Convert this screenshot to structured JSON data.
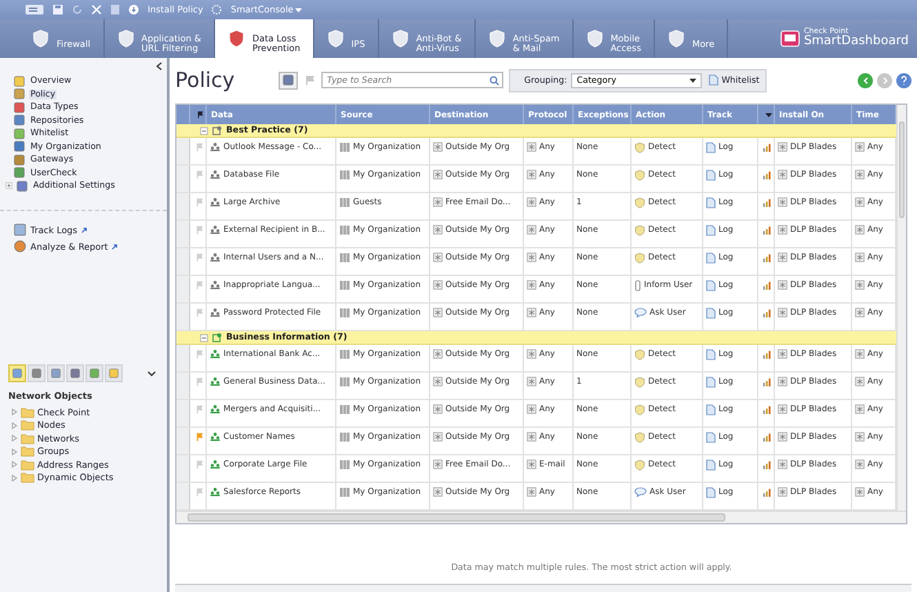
{
  "toolbar": {
    "install": "Install Policy",
    "console": "SmartConsole"
  },
  "tabs": [
    {
      "lines": [
        "Firewall"
      ],
      "selected": false
    },
    {
      "lines": [
        "Application &",
        "URL Filtering"
      ],
      "selected": false
    },
    {
      "lines": [
        "Data Loss",
        "Prevention"
      ],
      "selected": true
    },
    {
      "lines": [
        "IPS"
      ],
      "selected": false
    },
    {
      "lines": [
        "Anti-Bot &",
        "Anti-Virus"
      ],
      "selected": false
    },
    {
      "lines": [
        "Anti-Spam",
        "& Mail"
      ],
      "selected": false
    },
    {
      "lines": [
        "Mobile",
        "Access"
      ],
      "selected": false
    },
    {
      "lines": [
        "More"
      ],
      "selected": false
    }
  ],
  "brand": {
    "line1": "Check Point",
    "line2": "SmartDashboard"
  },
  "nav": [
    {
      "label": "Overview",
      "selected": false,
      "expandable": false
    },
    {
      "label": "Policy",
      "selected": true,
      "expandable": false
    },
    {
      "label": "Data Types",
      "selected": false,
      "expandable": false
    },
    {
      "label": "Repositories",
      "selected": false,
      "expandable": false
    },
    {
      "label": "Whitelist",
      "selected": false,
      "expandable": false
    },
    {
      "label": "My Organization",
      "selected": false,
      "expandable": false
    },
    {
      "label": "Gateways",
      "selected": false,
      "expandable": false
    },
    {
      "label": "UserCheck",
      "selected": false,
      "expandable": false
    },
    {
      "label": "Additional Settings",
      "selected": false,
      "expandable": true
    }
  ],
  "links": [
    "Track Logs",
    "Analyze & Report"
  ],
  "object_tools": [
    {
      "selected": true
    },
    {
      "selected": false
    },
    {
      "selected": false
    },
    {
      "selected": false
    },
    {
      "selected": false
    },
    {
      "selected": false
    }
  ],
  "objects": {
    "title": "Network Objects",
    "tree": [
      {
        "label": "Check Point",
        "expanded": false
      },
      {
        "label": "Nodes",
        "expanded": false
      },
      {
        "label": "Networks",
        "expanded": false
      },
      {
        "label": "Groups",
        "expanded": false
      },
      {
        "label": "Address Ranges",
        "expanded": false
      },
      {
        "label": "Dynamic Objects",
        "expanded": false
      }
    ]
  },
  "policy": {
    "title": "Policy",
    "search_placeholder": "Type to Search",
    "grouping_label": "Grouping:",
    "grouping_value": "Category",
    "whitelist": "Whitelist"
  },
  "table": {
    "columns": [
      "Data",
      "Source",
      "Destination",
      "Protocol",
      "Exceptions",
      "Action",
      "Track",
      "Install On",
      "Time"
    ],
    "groups": [
      {
        "label": "Best Practice",
        "count": "(7)",
        "expanded": true,
        "color": "#7a7a7a",
        "rows": [
          {
            "flagged": false,
            "data": "Outlook Message - Co...",
            "source": "My Organization",
            "destination": "Outside My Org",
            "protocol": "Any",
            "exceptions": "None",
            "action": "Detect",
            "kind": "detect",
            "track": "Log",
            "install_on": "DLP Blades",
            "time": "Any"
          },
          {
            "flagged": false,
            "data": "Database File",
            "source": "My Organization",
            "destination": "Outside My Org",
            "protocol": "Any",
            "exceptions": "None",
            "action": "Detect",
            "kind": "detect",
            "track": "Log",
            "install_on": "DLP Blades",
            "time": "Any"
          },
          {
            "flagged": false,
            "data": "Large Archive",
            "source": "Guests",
            "destination": "Free Email Do...",
            "protocol": "Any",
            "exceptions": "1",
            "action": "Detect",
            "kind": "detect",
            "track": "Log",
            "install_on": "DLP Blades",
            "time": "Any"
          },
          {
            "flagged": false,
            "data": "External Recipient in B...",
            "source": "My Organization",
            "destination": "Outside My Org",
            "protocol": "Any",
            "exceptions": "None",
            "action": "Detect",
            "kind": "detect",
            "track": "Log",
            "install_on": "DLP Blades",
            "time": "Any"
          },
          {
            "flagged": false,
            "data": "Internal Users and a N...",
            "source": "My Organization",
            "destination": "Outside My Org",
            "protocol": "Any",
            "exceptions": "None",
            "action": "Detect",
            "kind": "detect",
            "track": "Log",
            "install_on": "DLP Blades",
            "time": "Any"
          },
          {
            "flagged": false,
            "data": "Inappropriate Langua...",
            "source": "My Organization",
            "destination": "Outside My Org",
            "protocol": "Any",
            "exceptions": "None",
            "action": "Inform User",
            "kind": "inform",
            "track": "Log",
            "install_on": "DLP Blades",
            "time": "Any"
          },
          {
            "flagged": false,
            "data": "Password Protected File",
            "source": "My Organization",
            "destination": "Outside My Org",
            "protocol": "Any",
            "exceptions": "None",
            "action": "Ask User",
            "kind": "ask",
            "track": "Log",
            "install_on": "DLP Blades",
            "time": "Any"
          }
        ]
      },
      {
        "label": "Business Information",
        "count": "(7)",
        "expanded": true,
        "color": "#3aa048",
        "rows": [
          {
            "flagged": false,
            "data": "International Bank Ac...",
            "source": "My Organization",
            "destination": "Outside My Org",
            "protocol": "Any",
            "exceptions": "None",
            "action": "Detect",
            "kind": "detect",
            "track": "Log",
            "install_on": "DLP Blades",
            "time": "Any"
          },
          {
            "flagged": false,
            "data": "General Business Data...",
            "source": "My Organization",
            "destination": "Outside My Org",
            "protocol": "Any",
            "exceptions": "1",
            "action": "Detect",
            "kind": "detect",
            "track": "Log",
            "install_on": "DLP Blades",
            "time": "Any"
          },
          {
            "flagged": false,
            "data": "Mergers and Acquisiti...",
            "source": "My Organization",
            "destination": "Outside My Org",
            "protocol": "Any",
            "exceptions": "None",
            "action": "Detect",
            "kind": "detect",
            "track": "Log",
            "install_on": "DLP Blades",
            "time": "Any"
          },
          {
            "flagged": true,
            "data": "Customer Names",
            "source": "My Organization",
            "destination": "Outside My Org",
            "protocol": "Any",
            "exceptions": "None",
            "action": "Detect",
            "kind": "detect",
            "track": "Log",
            "install_on": "DLP Blades",
            "time": "Any"
          },
          {
            "flagged": false,
            "data": "Corporate Large File",
            "source": "My Organization",
            "destination": "Free Email Do...",
            "protocol": "E-mail",
            "exceptions": "None",
            "action": "Detect",
            "kind": "detect",
            "track": "Log",
            "install_on": "DLP Blades",
            "time": "Any"
          },
          {
            "flagged": false,
            "data": "Salesforce Reports",
            "source": "My Organization",
            "destination": "Outside My Org",
            "protocol": "Any",
            "exceptions": "None",
            "action": "Ask User",
            "kind": "ask",
            "track": "Log",
            "install_on": "DLP Blades",
            "time": "Any"
          }
        ]
      }
    ]
  },
  "footer": "Data may match multiple rules. The most strict action will apply."
}
